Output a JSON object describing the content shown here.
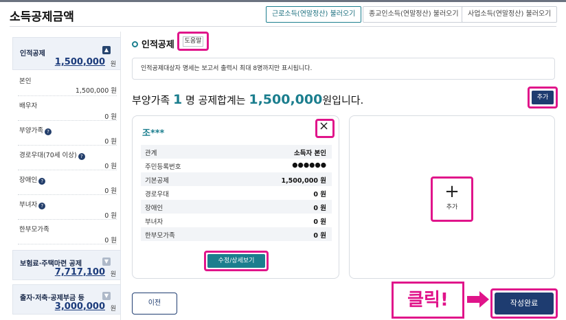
{
  "page": {
    "title": "소득공제금액"
  },
  "top_buttons": {
    "earned": "근로소득(연말정산) 불러오기",
    "religious": "종교인소득(연말정산) 불러오기",
    "business": "사업소득(연말정산) 불러오기"
  },
  "sidebar": {
    "personal": {
      "title": "인적공제",
      "total": "1,500,000",
      "unit": "원",
      "items": [
        {
          "label": "본인",
          "value": "1,500,000 원"
        },
        {
          "label": "배우자",
          "value": "0 원"
        },
        {
          "label": "부양가족",
          "value": "0 원",
          "info": "?"
        },
        {
          "label": "경로우대(70세 이상)",
          "value": "0 원",
          "info": "?"
        },
        {
          "label": "장애인",
          "value": "0 원",
          "info": "?"
        },
        {
          "label": "부녀자",
          "value": "0 원",
          "info": "?"
        },
        {
          "label": "한부모가족",
          "value": "0 원"
        }
      ]
    },
    "insurance": {
      "title": "보험료·주택마련 공제",
      "total": "7,717,100",
      "unit": "원"
    },
    "investment": {
      "title": "출자·저축·공제부금 등",
      "total": "3,000,000",
      "unit": "원"
    }
  },
  "main": {
    "section_title": "인적공제",
    "help_label": "도움말",
    "notice": "인적공제대상자 명세는 보고서 출력시 최대 8명까지만 표시됩니다.",
    "summary": {
      "prefix": "부양가족",
      "count": "1",
      "middle": "명 공제합계는",
      "amount": "1,500,000",
      "suffix": "원입니다."
    },
    "add_label": "추가",
    "card": {
      "name": "조***",
      "close_icon": "×",
      "rows": [
        {
          "key": "관계",
          "value": "소득자 본인"
        },
        {
          "key": "주민등록번호",
          "value": "●●●●●●"
        },
        {
          "key": "기본공제",
          "value": "1,500,000 원"
        },
        {
          "key": "경로우대",
          "value": "0 원"
        },
        {
          "key": "장애인",
          "value": "0 원"
        },
        {
          "key": "부녀자",
          "value": "0 원"
        },
        {
          "key": "한부모가족",
          "value": "0 원"
        }
      ],
      "edit_label": "수정/상세보기"
    },
    "add_card": {
      "plus_icon": "+",
      "label": "추가"
    }
  },
  "footer": {
    "prev_label": "이전",
    "click_label": "클릭!",
    "done_label": "작성완료"
  },
  "colors": {
    "teal": "#1b7e8e",
    "navy": "#1e3c70",
    "highlight": "#e0148a"
  }
}
